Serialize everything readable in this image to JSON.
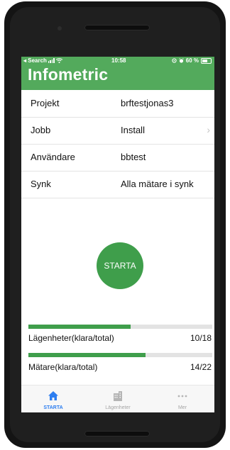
{
  "status_bar": {
    "back_label": "◂ Search",
    "time": "10:58",
    "battery": "60 %"
  },
  "header": {
    "title": "Infometric"
  },
  "rows": [
    {
      "label": "Projekt",
      "value": "brftestjonas3"
    },
    {
      "label": "Jobb",
      "value": "Install",
      "chevron": "›"
    },
    {
      "label": "Användare",
      "value": "bbtest"
    },
    {
      "label": "Synk",
      "value": "Alla mätare i synk"
    }
  ],
  "start_button": {
    "label": "STARTA"
  },
  "progress": [
    {
      "label": "Lägenheter(klara/total)",
      "value": "10/18",
      "fraction": 0.556
    },
    {
      "label": "Mätare(klara/total)",
      "value": "14/22",
      "fraction": 0.636
    }
  ],
  "tabs": [
    {
      "label": "STARTA",
      "icon": "home-icon",
      "active": true
    },
    {
      "label": "Lägenheter",
      "icon": "building-icon",
      "active": false
    },
    {
      "label": "Mer",
      "icon": "more-dots-icon",
      "active": false
    }
  ],
  "colors": {
    "accent": "#53aa5c",
    "button": "#3f9e4b",
    "tab_active": "#2d7ef0"
  }
}
